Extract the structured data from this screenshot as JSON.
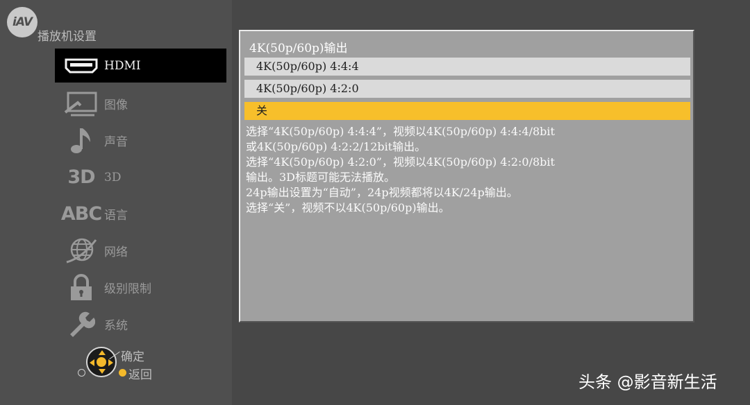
{
  "logo": {
    "text": "iAV"
  },
  "sidebar": {
    "title": "播放机设置",
    "items": [
      {
        "label": "HDMI",
        "icon": "hdmi-icon",
        "active": true
      },
      {
        "label": "图像",
        "icon": "monitor-icon"
      },
      {
        "label": "声音",
        "icon": "music-note-icon"
      },
      {
        "label": "3D",
        "icon": "3d-icon",
        "icon_text": "3D"
      },
      {
        "label": "语言",
        "icon": "abc-icon",
        "icon_text": "ABC"
      },
      {
        "label": "网络",
        "icon": "globe-icon"
      },
      {
        "label": "级别限制",
        "icon": "lock-icon"
      },
      {
        "label": "系统",
        "icon": "wrench-icon"
      }
    ]
  },
  "nav_hint": {
    "ok_label": "确定",
    "back_label": "返回"
  },
  "panel": {
    "title": "4K(50p/60p)输出",
    "options": [
      {
        "label": "4K(50p/60p) 4:4:4"
      },
      {
        "label": "4K(50p/60p) 4:2:0"
      },
      {
        "label": "关",
        "selected": true
      }
    ],
    "description": [
      "选择“4K(50p/60p) 4:4:4”，视频以4K(50p/60p) 4:4:4/8bit",
      "或4K(50p/60p) 4:2:2/12bit输出。",
      "选择“4K(50p/60p) 4:2:0”，视频以4K(50p/60p) 4:2:0/8bit",
      "输出。3D标题可能无法播放。",
      "24p输出设置为“自动”，24p视频都将以4K/24p输出。",
      "选择“关”，视频不以4K(50p/60p)输出。"
    ]
  },
  "watermark": {
    "text": "头条 @影音新生活"
  },
  "colors": {
    "selected": "#f7bf2b",
    "option_bg": "#dadada",
    "panel_bg": "#a0a0a0",
    "sidebar_bg": "#4f4f4f"
  }
}
